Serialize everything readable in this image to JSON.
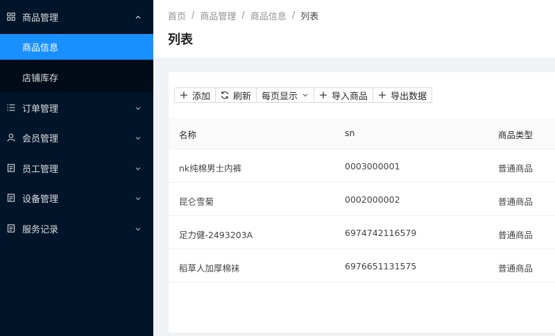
{
  "sidebar": {
    "items": [
      {
        "label": "商品管理",
        "icon": "appstore-icon",
        "expanded": true
      },
      {
        "label": "订单管理",
        "icon": "list-icon"
      },
      {
        "label": "会员管理",
        "icon": "user-icon"
      },
      {
        "label": "员工管理",
        "icon": "document-icon"
      },
      {
        "label": "设备管理",
        "icon": "document-icon"
      },
      {
        "label": "服务记录",
        "icon": "document-icon"
      }
    ],
    "subitems": [
      {
        "label": "商品信息",
        "active": true
      },
      {
        "label": "店铺库存"
      }
    ]
  },
  "header": {
    "breadcrumb": [
      "首页",
      "商品管理",
      "商品信息",
      "列表"
    ],
    "title": "列表"
  },
  "toolbar": {
    "add": "添加",
    "refresh": "刷新",
    "page_size": "每页显示",
    "import": "导入商品",
    "export": "导出数据"
  },
  "table": {
    "columns": [
      "名称",
      "sn",
      "商品类型"
    ],
    "rows": [
      [
        "nk纯棉男士内裤",
        "0003000001",
        "普通商品"
      ],
      [
        "昆仑雪菊",
        "0002000002",
        "普通商品"
      ],
      [
        "足力健-2493203A",
        "6974742116579",
        "普通商品"
      ],
      [
        "稻草人加厚棉袜",
        "6976651131575",
        "普通商品"
      ]
    ]
  },
  "colors": {
    "sidebar_bg": "#001529",
    "submenu_bg": "#000c17",
    "active": "#1890ff"
  }
}
